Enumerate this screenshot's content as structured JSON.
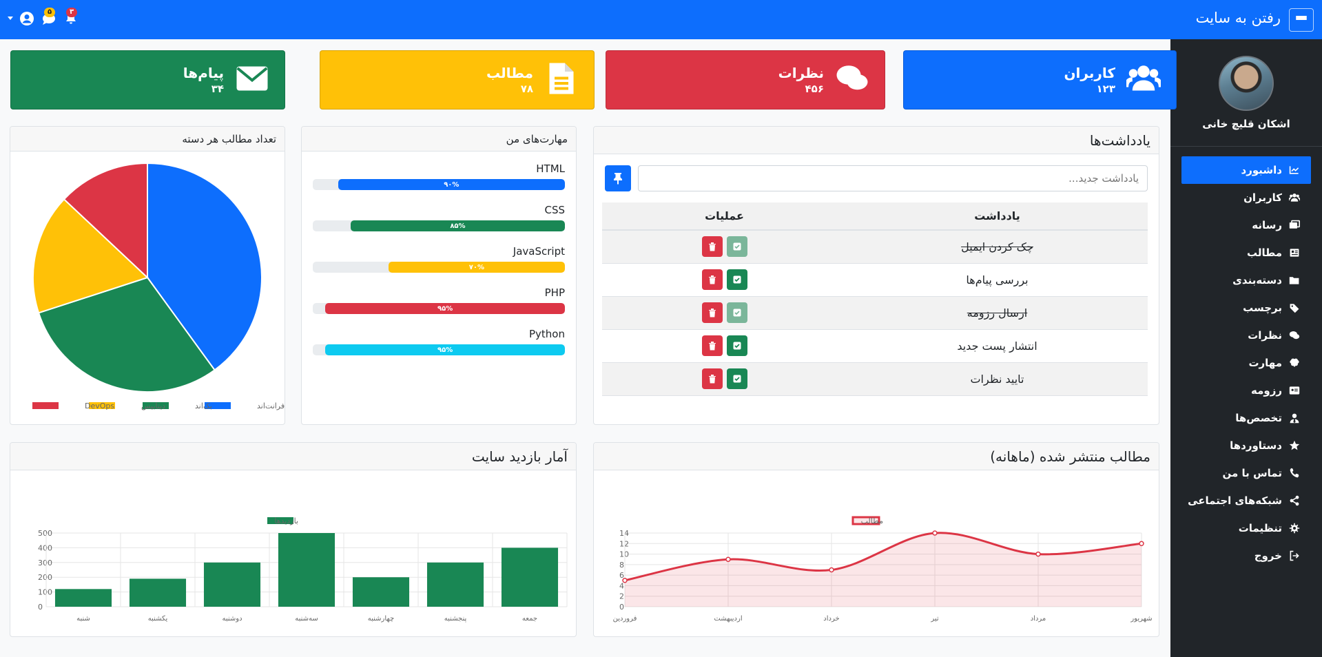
{
  "topbar": {
    "brand": "رفتن به سایت",
    "notifications_badge": "۳",
    "messages_badge": "۵"
  },
  "sidebar": {
    "user_name": "اشکان قلیچ خانی",
    "items": [
      {
        "label": "داشبورد",
        "icon": "chart-icon",
        "active": true
      },
      {
        "label": "کاربران",
        "icon": "users-icon"
      },
      {
        "label": "رسانه",
        "icon": "images-icon"
      },
      {
        "label": "مطالب",
        "icon": "newspaper-icon"
      },
      {
        "label": "دسته‌بندی",
        "icon": "folder-icon"
      },
      {
        "label": "برچسب",
        "icon": "tags-icon"
      },
      {
        "label": "نظرات",
        "icon": "comments-icon"
      },
      {
        "label": "مهارت",
        "icon": "brain-icon"
      },
      {
        "label": "رزومه",
        "icon": "id-card-icon"
      },
      {
        "label": "تخصص‌ها",
        "icon": "user-tie-icon"
      },
      {
        "label": "دستاوردها",
        "icon": "star-icon"
      },
      {
        "label": "تماس با من",
        "icon": "phone-icon"
      },
      {
        "label": "شبکه‌های اجتماعی",
        "icon": "share-icon"
      },
      {
        "label": "تنظیمات",
        "icon": "gear-icon"
      },
      {
        "label": "خروج",
        "icon": "sign-out-icon"
      }
    ]
  },
  "stats": [
    {
      "title": "کاربران",
      "value": "۱۲۳",
      "color": "#0d6efd",
      "icon": "users-icon"
    },
    {
      "title": "نظرات",
      "value": "۴۵۶",
      "color": "#dc3545",
      "icon": "comments-icon"
    },
    {
      "title": "مطالب",
      "value": "۷۸",
      "color": "#ffc107",
      "icon": "file-icon"
    },
    {
      "title": "پیام‌ها",
      "value": "۳۴",
      "color": "#198754",
      "icon": "envelope-icon"
    }
  ],
  "notes": {
    "title": "یادداشت‌ها",
    "placeholder": "یادداشت جدید...",
    "col_note": "یادداشت",
    "col_ops": "عملیات",
    "rows": [
      {
        "text": "چک کردن ایمیل",
        "done": true
      },
      {
        "text": "بررسی پیام‌ها",
        "done": false
      },
      {
        "text": "ارسال رزومه",
        "done": true
      },
      {
        "text": "انتشار پست جدید",
        "done": false
      },
      {
        "text": "تایید نظرات",
        "done": false
      }
    ]
  },
  "skills": {
    "title": "مهارت‌های من",
    "items": [
      {
        "name": "HTML",
        "percent": 90,
        "label": "۹۰%",
        "color": "#0d6efd"
      },
      {
        "name": "CSS",
        "percent": 85,
        "label": "۸۵%",
        "color": "#198754"
      },
      {
        "name": "JavaScript",
        "percent": 70,
        "label": "۷۰%",
        "color": "#ffc107"
      },
      {
        "name": "PHP",
        "percent": 95,
        "label": "۹۵%",
        "color": "#dc3545"
      },
      {
        "name": "Python",
        "percent": 95,
        "label": "۹۵%",
        "color": "#0dcaf0"
      }
    ]
  },
  "pie_panel_title": "تعداد مطالب هر دسته",
  "line_panel_title": "مطالب منتشر شده (ماهانه)",
  "bar_panel_title": "آمار بازدید سایت",
  "chart_data": [
    {
      "type": "pie",
      "categories": [
        "فرانت‌اند",
        "بک‌اند",
        "دیتابیس",
        "DevOps"
      ],
      "values": [
        40,
        30,
        17,
        13
      ],
      "colors": [
        "#0d6efd",
        "#198754",
        "#ffc107",
        "#dc3545"
      ],
      "legend": "bottom"
    },
    {
      "type": "area",
      "categories": [
        "فروردین",
        "اردیبهشت",
        "خرداد",
        "تیر",
        "مرداد",
        "شهریور"
      ],
      "series": [
        {
          "name": "مطالب",
          "values": [
            5,
            9,
            7,
            14,
            10,
            12
          ],
          "color": "#dc3545"
        }
      ],
      "ylim": [
        0,
        14
      ],
      "yticks": [
        "0",
        "2",
        "4",
        "6",
        "8",
        "10",
        "12",
        "14"
      ],
      "legend": "top",
      "grid": true
    },
    {
      "type": "bar",
      "categories": [
        "شنبه",
        "یکشنبه",
        "دوشنبه",
        "سه‌شنبه",
        "چهارشنبه",
        "پنجشنبه",
        "جمعه"
      ],
      "series": [
        {
          "name": "بازدیدها",
          "values": [
            120,
            190,
            300,
            500,
            200,
            300,
            400
          ],
          "color": "#198754"
        }
      ],
      "ylim": [
        0,
        500
      ],
      "yticks": [
        "0",
        "100",
        "200",
        "300",
        "400",
        "500"
      ],
      "legend": "top",
      "grid": true
    }
  ]
}
